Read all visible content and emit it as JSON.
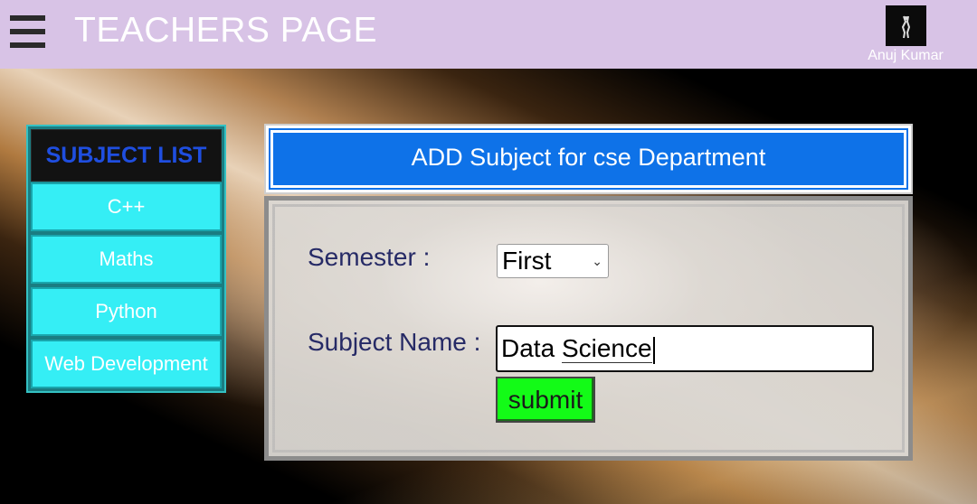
{
  "header": {
    "title": "TEACHERS PAGE",
    "user_name": "Anuj Kumar",
    "background_color": "#d8c3e6"
  },
  "subject_list": {
    "heading": "SUBJECT LIST",
    "items": [
      {
        "label": "C++"
      },
      {
        "label": "Maths"
      },
      {
        "label": "Python"
      },
      {
        "label": "Web Development"
      }
    ],
    "item_color": "#35eef5",
    "heading_color": "#1f4ee0"
  },
  "add_subject": {
    "heading": "ADD Subject for cse Department",
    "heading_bg": "#0e72e8",
    "semester_label": "Semester :",
    "semester_value": "First",
    "subject_name_label": "Subject Name :",
    "subject_name_value_part1": "Data ",
    "subject_name_value_part2": "Science",
    "submit_label": "submit",
    "submit_color": "#13fb17"
  }
}
